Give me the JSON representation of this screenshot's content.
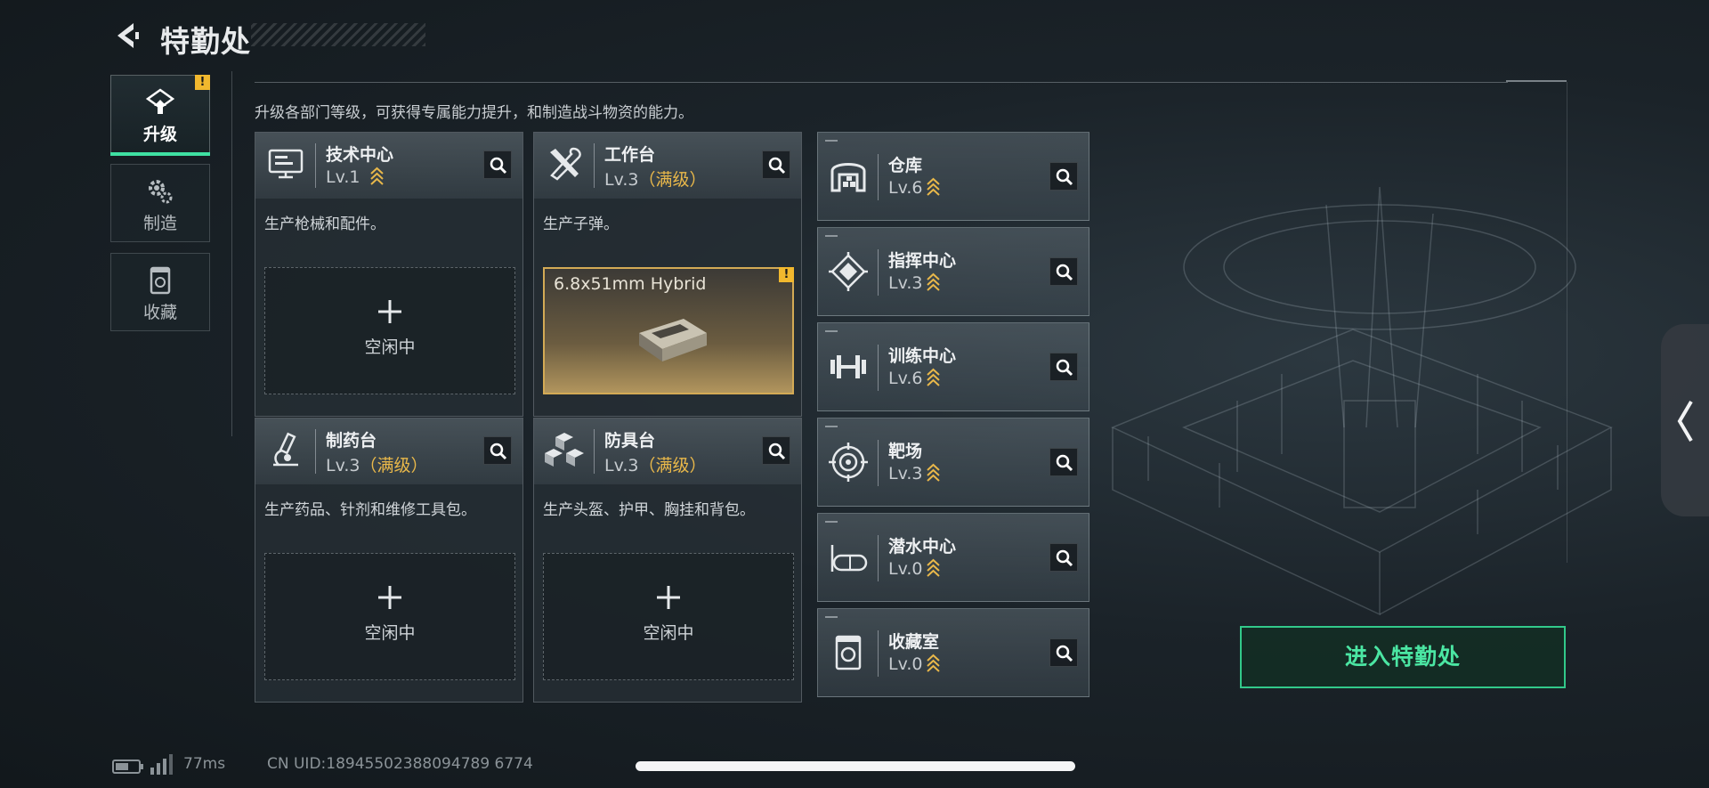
{
  "header": {
    "title": "特勤处"
  },
  "tabs": [
    {
      "label": "升级",
      "active": true,
      "alert": "!"
    },
    {
      "label": "制造",
      "active": false
    },
    {
      "label": "收藏",
      "active": false
    }
  ],
  "intro": "升级各部门等级，可获得专属能力提升，和制造战斗物资的能力。",
  "cards": [
    {
      "name": "技术中心",
      "level": "Lv.1",
      "max_label": "",
      "desc": "生产枪械和配件。",
      "slot_label": "空闲中"
    },
    {
      "name": "工作台",
      "level": "Lv.3",
      "max_label": "（满级）",
      "desc": "生产子弹。",
      "product_name": "6.8x51mm Hybrid",
      "product_alert": "!"
    },
    {
      "name": "制药台",
      "level": "Lv.3",
      "max_label": "（满级）",
      "desc": "生产药品、针剂和维修工具包。",
      "slot_label": "空闲中"
    },
    {
      "name": "防具台",
      "level": "Lv.3",
      "max_label": "（满级）",
      "desc": "生产头盔、护甲、胸挂和背包。",
      "slot_label": "空闲中"
    }
  ],
  "rows": [
    {
      "name": "仓库",
      "level": "Lv.6"
    },
    {
      "name": "指挥中心",
      "level": "Lv.3"
    },
    {
      "name": "训练中心",
      "level": "Lv.6"
    },
    {
      "name": "靶场",
      "level": "Lv.3"
    },
    {
      "name": "潜水中心",
      "level": "Lv.0"
    },
    {
      "name": "收藏室",
      "level": "Lv.0"
    }
  ],
  "enter_button": "进入特勤处",
  "status": {
    "ping": "77ms",
    "uid": "CN UID:18945502388094789 6774"
  },
  "icons": {
    "back": "back-arrow-icon",
    "upgrade": "upgrade-icon",
    "craft": "gear-icon",
    "collection": "collection-icon",
    "search": "search-icon",
    "level_up": "chevron-up-icon"
  },
  "colors": {
    "accent_green": "#3fe0a2",
    "max_level_gold": "#e9b84a",
    "alert_yellow": "#f1b82e"
  }
}
